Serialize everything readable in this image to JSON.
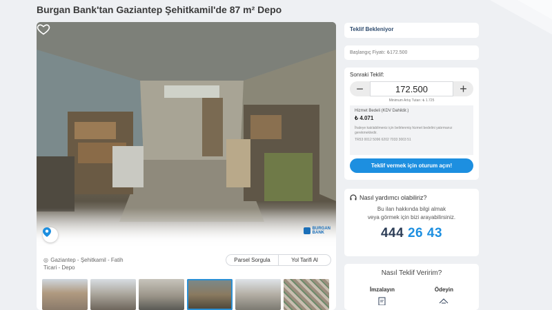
{
  "page": {
    "title": "Burgan Bank'tan Gaziantep Şehitkamil'de 87 m² Depo"
  },
  "gallery": {
    "favorite_icon": "heart-outline-icon",
    "pin_icon": "location-pin-icon",
    "brand_logo_lines": [
      "BURGAN",
      "BANK"
    ],
    "location_icon": "map-marker-icon",
    "location_line1": "Gaziantep - Şehitkamil - Fatih",
    "location_line2": "Ticari - Depo",
    "parcel_button": "Parsel Sorgula",
    "directions_button": "Yol Tarifi Al",
    "thumbnails": 6,
    "active_thumbnail": 4
  },
  "status": {
    "label": "Teklif Bekleniyor"
  },
  "start_price": {
    "text": "Başlangıç Fiyatı: ₺172.500"
  },
  "bid": {
    "label": "Sonraki Teklif:",
    "value": "172.500",
    "min_step": "Minimum Artış Tutarı: ₺ 1.725",
    "fee_label": "Hizmet Bedeli (KDV Dahildir.)",
    "fee_value": "₺ 4.071",
    "fee_note": "İhaleye katılabilmeniz için belirlenmiş hizmet bedelini yatırmanız gerekmektedir.",
    "iban": "TR53 0012 5096 6202 7033 3003 51",
    "cta": "Teklif vermek için oturum açın!"
  },
  "help": {
    "icon": "headset-icon",
    "title": "Nasıl yardımcı olabiliriz?",
    "line1": "Bu ilan hakkında bilgi almak",
    "line2": "veya görmek için bizi arayabilirsiniz.",
    "phone_a": "444",
    "phone_b": "26 43"
  },
  "how": {
    "title": "Nasıl Teklif Veririm?",
    "step1": "İmzalayın",
    "step2": "Ödeyin"
  },
  "colors": {
    "accent": "#1d8fe0",
    "navy": "#2d3e57",
    "background": "#eef0f3"
  }
}
